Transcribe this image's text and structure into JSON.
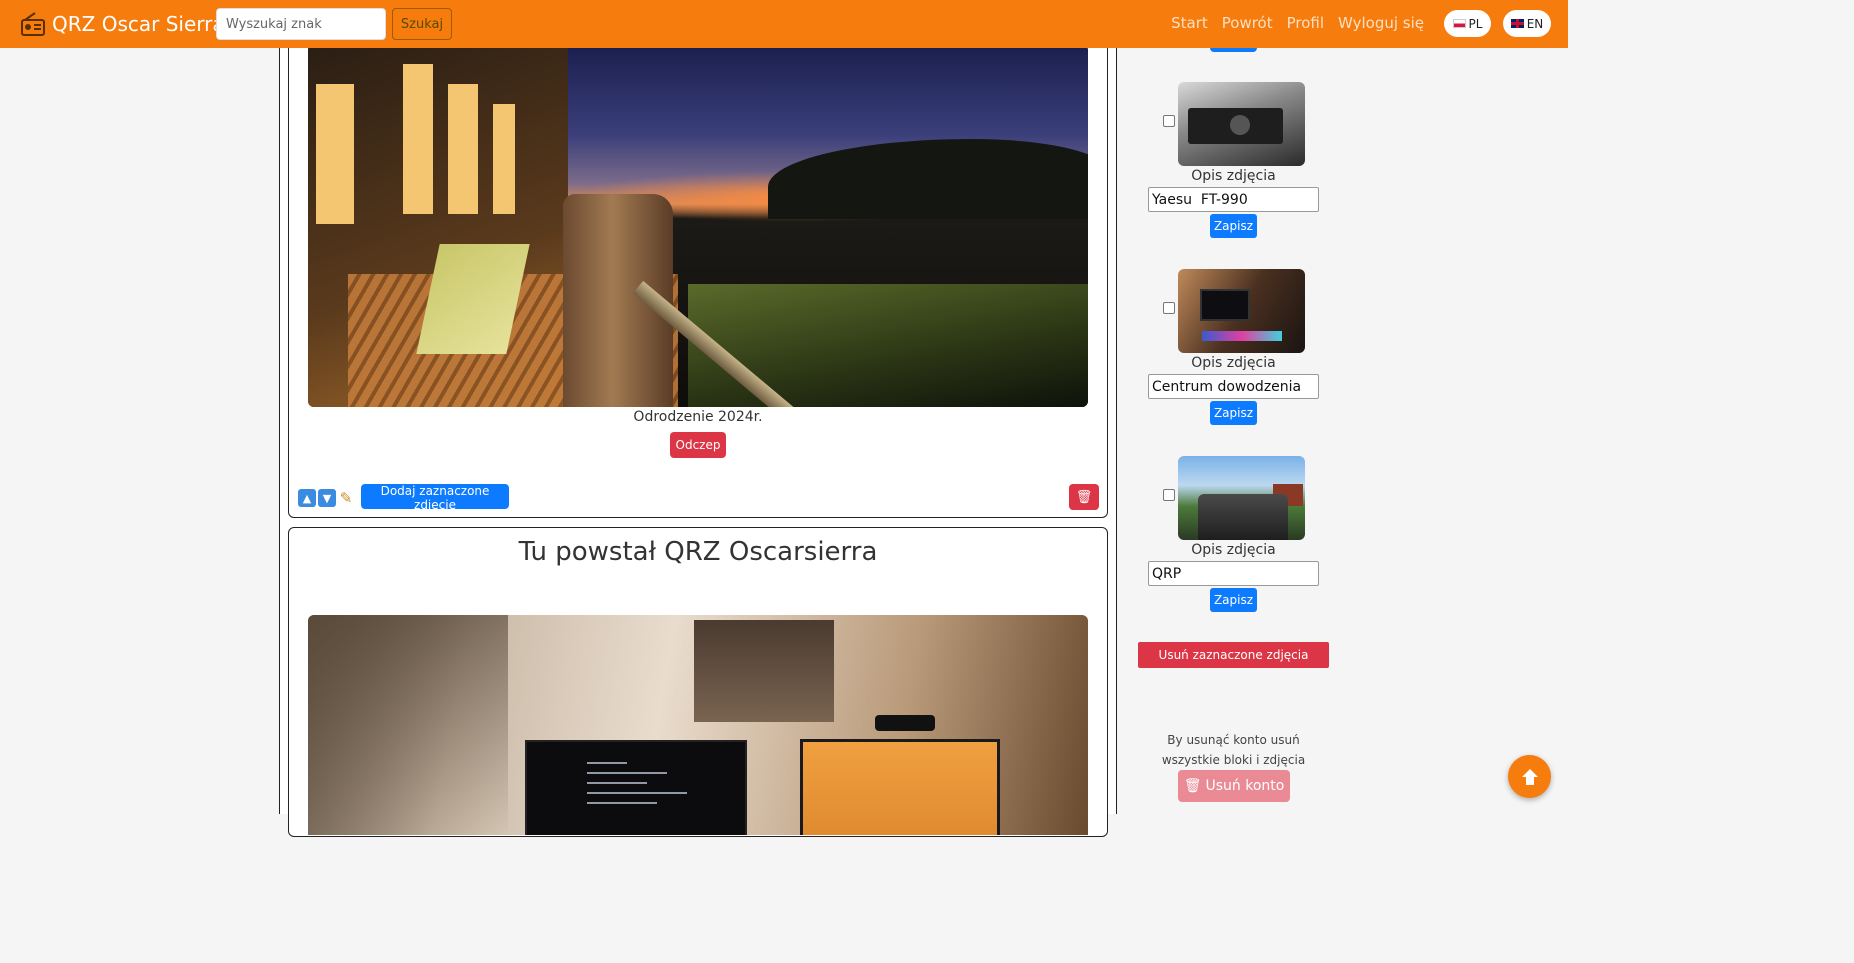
{
  "header": {
    "brand": "QRZ Oscar Sierra",
    "search_placeholder": "Wyszukaj znak",
    "search_button": "Szukaj",
    "nav": [
      "Start",
      "Powrót",
      "Profil",
      "Wyloguj się"
    ],
    "lang_pl": "PL",
    "lang_en": "EN"
  },
  "block1": {
    "caption": "Odrodzenie 2024r.",
    "detach_button": "Odczep",
    "add_selected_button": "Dodaj zaznaczone zdjęcie"
  },
  "block2": {
    "title": "Tu powstał QRZ Oscarsierra"
  },
  "sidebar": {
    "photos": [
      {
        "label": "Opis zdjęcia",
        "description": "Yaesu  FT-990",
        "save": "Zapisz"
      },
      {
        "label": "Opis zdjęcia",
        "description": "Centrum dowodzenia",
        "save": "Zapisz"
      },
      {
        "label": "Opis zdjęcia",
        "description": "QRP",
        "save": "Zapisz"
      }
    ],
    "delete_selected_button": "Usuń zaznaczone zdjęcia",
    "delete_note": "By usunąć konto usuń wszystkie bloki i zdjęcia",
    "delete_account_button": "Usuń konto"
  },
  "colors": {
    "navbar": "#f57c0d",
    "primary": "#0d7bff",
    "danger": "#dc3545"
  }
}
